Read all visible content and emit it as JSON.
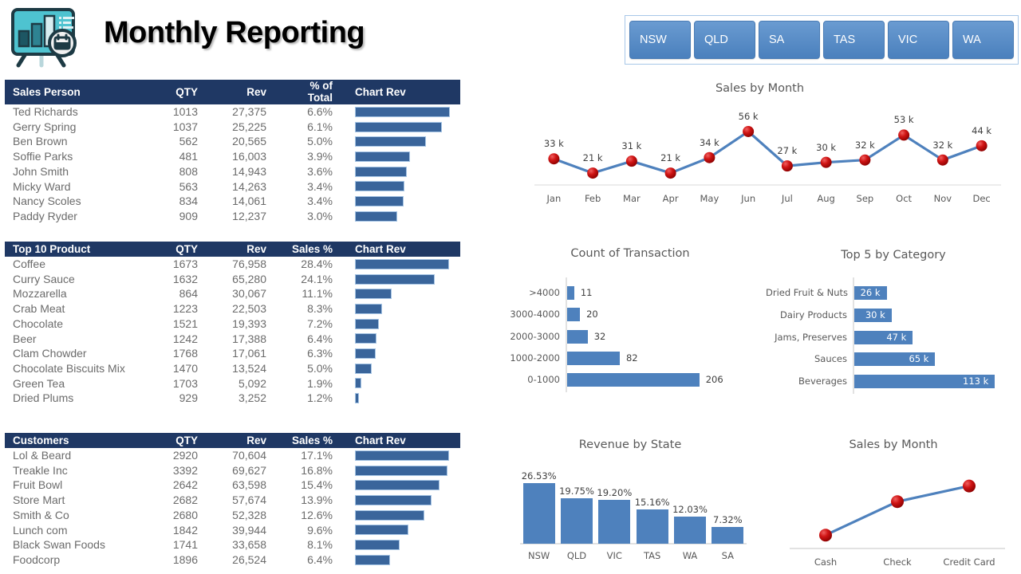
{
  "header": {
    "title": "Monthly Reporting",
    "logo_icon": "presentation-chart-easel-icon"
  },
  "colors": {
    "table_header_bg": "#1F3864",
    "table_bar": "#3A659B",
    "chart_blue": "#4E81BD",
    "marker_red": "#C00000",
    "slicer_border": "#A8C7E8",
    "text_gray": "#595959"
  },
  "slicer": {
    "name": "state-slicer",
    "buttons": [
      "NSW",
      "QLD",
      "SA",
      "TAS",
      "VIC",
      "WA"
    ]
  },
  "tables": [
    {
      "id": "sales-person-table",
      "columns": [
        "Sales Person",
        "QTY",
        "Rev",
        "% of Total",
        "Chart Rev"
      ],
      "rows": [
        {
          "name": "Ted Richards",
          "qty": "1013",
          "rev": "27,375",
          "pct": "6.6%",
          "bar": 27375
        },
        {
          "name": "Gerry Spring",
          "qty": "1037",
          "rev": "25,225",
          "pct": "6.1%",
          "bar": 25225
        },
        {
          "name": "Ben Brown",
          "qty": "562",
          "rev": "20,565",
          "pct": "5.0%",
          "bar": 20565
        },
        {
          "name": "Soffie Parks",
          "qty": "481",
          "rev": "16,003",
          "pct": "3.9%",
          "bar": 16003
        },
        {
          "name": "John Smith",
          "qty": "808",
          "rev": "14,943",
          "pct": "3.6%",
          "bar": 14943
        },
        {
          "name": "Micky Ward",
          "qty": "563",
          "rev": "14,263",
          "pct": "3.4%",
          "bar": 14263
        },
        {
          "name": "Nancy Scoles",
          "qty": "834",
          "rev": "14,061",
          "pct": "3.4%",
          "bar": 14061
        },
        {
          "name": "Paddy Ryder",
          "qty": "909",
          "rev": "12,237",
          "pct": "3.0%",
          "bar": 12237
        }
      ],
      "bar_max": 30000
    },
    {
      "id": "top-10-product-table",
      "columns": [
        "Top 10 Product",
        "QTY",
        "Rev",
        "Sales %",
        "Chart Rev"
      ],
      "rows": [
        {
          "name": "Coffee",
          "qty": "1673",
          "rev": "76,958",
          "pct": "28.4%",
          "bar": 76958
        },
        {
          "name": "Curry Sauce",
          "qty": "1632",
          "rev": "65,280",
          "pct": "24.1%",
          "bar": 65280
        },
        {
          "name": "Mozzarella",
          "qty": "864",
          "rev": "30,067",
          "pct": "11.1%",
          "bar": 30067
        },
        {
          "name": "Crab Meat",
          "qty": "1223",
          "rev": "22,503",
          "pct": "8.3%",
          "bar": 22503
        },
        {
          "name": "Chocolate",
          "qty": "1521",
          "rev": "19,393",
          "pct": "7.2%",
          "bar": 19393
        },
        {
          "name": "Beer",
          "qty": "1242",
          "rev": "17,388",
          "pct": "6.4%",
          "bar": 17388
        },
        {
          "name": "Clam Chowder",
          "qty": "1768",
          "rev": "17,061",
          "pct": "6.3%",
          "bar": 17061
        },
        {
          "name": "Chocolate Biscuits Mix",
          "qty": "1470",
          "rev": "13,524",
          "pct": "5.0%",
          "bar": 13524
        },
        {
          "name": "Green Tea",
          "qty": "1703",
          "rev": "5,092",
          "pct": "1.9%",
          "bar": 5092
        },
        {
          "name": "Dried Plums",
          "qty": "929",
          "rev": "3,252",
          "pct": "1.2%",
          "bar": 3252
        }
      ],
      "bar_max": 85000
    },
    {
      "id": "customers-table",
      "columns": [
        "Customers",
        "QTY",
        "Rev",
        "Sales %",
        "Chart Rev"
      ],
      "rows": [
        {
          "name": "Lol & Beard",
          "qty": "2920",
          "rev": "70,604",
          "pct": "17.1%",
          "bar": 70604
        },
        {
          "name": "Treakle Inc",
          "qty": "3392",
          "rev": "69,627",
          "pct": "16.8%",
          "bar": 69627
        },
        {
          "name": "Fruit Bowl",
          "qty": "2642",
          "rev": "63,598",
          "pct": "15.4%",
          "bar": 63598
        },
        {
          "name": "Store Mart",
          "qty": "2682",
          "rev": "57,674",
          "pct": "13.9%",
          "bar": 57674
        },
        {
          "name": "Smith & Co",
          "qty": "2680",
          "rev": "52,328",
          "pct": "12.6%",
          "bar": 52328
        },
        {
          "name": "Lunch com",
          "qty": "1842",
          "rev": "39,944",
          "pct": "9.6%",
          "bar": 39944
        },
        {
          "name": "Black Swan Foods",
          "qty": "1741",
          "rev": "33,658",
          "pct": "8.1%",
          "bar": 33658
        },
        {
          "name": "Foodcorp",
          "qty": "1896",
          "rev": "26,524",
          "pct": "6.4%",
          "bar": 26524
        }
      ],
      "bar_max": 78000
    }
  ],
  "chart_data": [
    {
      "id": "sales-by-month-line",
      "type": "line",
      "title": "Sales by Month",
      "xlabel": "",
      "ylabel": "",
      "categories": [
        "Jan",
        "Feb",
        "Mar",
        "Apr",
        "May",
        "Jun",
        "Jul",
        "Aug",
        "Sep",
        "Oct",
        "Nov",
        "Dec"
      ],
      "values": [
        33,
        21,
        31,
        21,
        34,
        56,
        27,
        30,
        32,
        53,
        32,
        44
      ],
      "data_labels": [
        "33 k",
        "21 k",
        "31 k",
        "21 k",
        "34 k",
        "56 k",
        "27 k",
        "30 k",
        "32 k",
        "53 k",
        "32 k",
        "44 k"
      ],
      "ylim": [
        15,
        60
      ],
      "grid": false,
      "legend": "none",
      "line_color": "#4E81BD",
      "marker_color": "#C00000"
    },
    {
      "id": "count-of-transaction-bar",
      "type": "bar",
      "orientation": "horizontal",
      "title": "Count of Transaction",
      "xlabel": "",
      "ylabel": "",
      "categories": [
        "0-1000",
        "1000-2000",
        "2000-3000",
        "3000-4000",
        ">4000"
      ],
      "values": [
        206,
        82,
        32,
        20,
        11
      ],
      "data_labels": [
        "206",
        "82",
        "32",
        "20",
        "11"
      ],
      "xlim": [
        0,
        230
      ],
      "grid": false,
      "legend": "none",
      "bar_color": "#4E81BD"
    },
    {
      "id": "top-5-by-category-bar",
      "type": "bar",
      "orientation": "horizontal",
      "title": "Top 5 by Category",
      "xlabel": "",
      "ylabel": "",
      "categories": [
        "Beverages",
        "Sauces",
        "Jams, Preserves",
        "Dairy Products",
        "Dried Fruit & Nuts"
      ],
      "values": [
        113,
        65,
        47,
        30,
        26
      ],
      "data_labels": [
        "113 k",
        "65 k",
        "47 k",
        "30 k",
        "26 k"
      ],
      "xlim": [
        0,
        125
      ],
      "grid": false,
      "legend": "none",
      "bar_color": "#4E81BD"
    },
    {
      "id": "revenue-by-state-column",
      "type": "bar",
      "orientation": "vertical",
      "title": "Revenue by State",
      "xlabel": "",
      "ylabel": "",
      "categories": [
        "NSW",
        "QLD",
        "VIC",
        "TAS",
        "WA",
        "SA"
      ],
      "values": [
        26.53,
        19.75,
        19.2,
        15.16,
        12.03,
        7.32
      ],
      "data_labels": [
        "26.53%",
        "19.75%",
        "19.20%",
        "15.16%",
        "12.03%",
        "7.32%"
      ],
      "ylim": [
        0,
        30
      ],
      "grid": false,
      "legend": "none",
      "bar_color": "#4E81BD"
    },
    {
      "id": "sales-by-payment-line",
      "type": "line",
      "title": "Sales by Month",
      "xlabel": "",
      "ylabel": "",
      "categories": [
        "Cash",
        "Check",
        "Credit Card"
      ],
      "values": [
        12,
        42,
        56
      ],
      "data_labels": [],
      "ylim": [
        0,
        70
      ],
      "grid": false,
      "legend": "none",
      "line_color": "#4E81BD",
      "marker_color": "#C00000"
    }
  ]
}
